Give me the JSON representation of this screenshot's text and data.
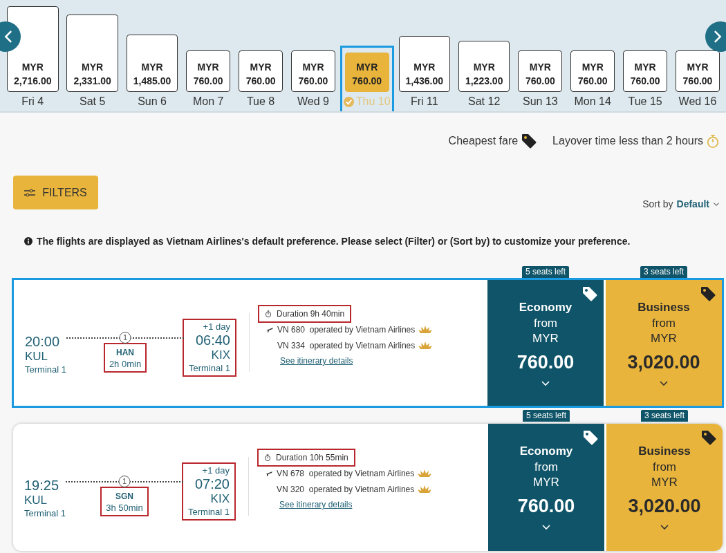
{
  "date_strip": {
    "dates": [
      {
        "day": "Fri 4",
        "currency": "MYR",
        "price": "2,716.00",
        "level": 1.0,
        "selected": false
      },
      {
        "day": "Sat 5",
        "currency": "MYR",
        "price": "2,331.00",
        "level": 0.9,
        "selected": false
      },
      {
        "day": "Sun 6",
        "currency": "MYR",
        "price": "1,485.00",
        "level": 0.67,
        "selected": false
      },
      {
        "day": "Mon 7",
        "currency": "MYR",
        "price": "760.00",
        "level": 0.48,
        "selected": false
      },
      {
        "day": "Tue 8",
        "currency": "MYR",
        "price": "760.00",
        "level": 0.48,
        "selected": false
      },
      {
        "day": "Wed 9",
        "currency": "MYR",
        "price": "760.00",
        "level": 0.48,
        "selected": false
      },
      {
        "day": "Thu 10",
        "currency": "MYR",
        "price": "760.00",
        "level": 0.46,
        "selected": true
      },
      {
        "day": "Fri 11",
        "currency": "MYR",
        "price": "1,436.00",
        "level": 0.65,
        "selected": false
      },
      {
        "day": "Sat 12",
        "currency": "MYR",
        "price": "1,223.00",
        "level": 0.6,
        "selected": false
      },
      {
        "day": "Sun 13",
        "currency": "MYR",
        "price": "760.00",
        "level": 0.48,
        "selected": false
      },
      {
        "day": "Mon 14",
        "currency": "MYR",
        "price": "760.00",
        "level": 0.48,
        "selected": false
      },
      {
        "day": "Tue 15",
        "currency": "MYR",
        "price": "760.00",
        "level": 0.48,
        "selected": false
      },
      {
        "day": "Wed 16",
        "currency": "MYR",
        "price": "760.00",
        "level": 0.48,
        "selected": false
      }
    ]
  },
  "legend": [
    {
      "kind": "cheapest",
      "label": "Cheapest fare"
    },
    {
      "kind": "layover",
      "label": "Layover time less than 2 hours"
    }
  ],
  "filters_button": "FILTERS",
  "sort": {
    "label": "Sort by",
    "value": "Default"
  },
  "notice": "The flights are displayed as Vietnam Airlines's default preference. Please select (Filter) or (Sort by) to customize your preference.",
  "flights": [
    {
      "selected": true,
      "depart": {
        "time": "20:00",
        "airport": "KUL",
        "terminal": "Terminal 1"
      },
      "stop": {
        "count": "1",
        "airport": "HAN",
        "layover": "2h 0min",
        "annotated": true
      },
      "arrive": {
        "day_offset": "+1 day",
        "time": "06:40",
        "airport": "KIX",
        "terminal": "Terminal 1",
        "annotated": true
      },
      "duration": {
        "text": "Duration 9h 40min",
        "annotated": true
      },
      "segments": [
        {
          "kind": "departure",
          "flight": "VN 680",
          "operator": "operated by Vietnam Airlines"
        },
        {
          "kind": "connection",
          "flight": "VN 334",
          "operator": "operated by Vietnam Airlines"
        }
      ],
      "link": "See itinerary details",
      "fares": [
        {
          "kind": "economy",
          "seats": "5 seats left",
          "cabin": "Economy",
          "from": "from",
          "currency": "MYR",
          "price": "760.00"
        },
        {
          "kind": "business",
          "seats": "3 seats left",
          "cabin": "Business",
          "from": "from",
          "currency": "MYR",
          "price": "3,020.00"
        }
      ]
    },
    {
      "selected": false,
      "depart": {
        "time": "19:25",
        "airport": "KUL",
        "terminal": "Terminal 1"
      },
      "stop": {
        "count": "1",
        "airport": "SGN",
        "layover": "3h 50min",
        "annotated": true
      },
      "arrive": {
        "day_offset": "+1 day",
        "time": "07:20",
        "airport": "KIX",
        "terminal": "Terminal 1",
        "annotated": true
      },
      "duration": {
        "text": "Duration 10h 55min",
        "annotated": true
      },
      "segments": [
        {
          "kind": "departure",
          "flight": "VN 678",
          "operator": "operated by Vietnam Airlines"
        },
        {
          "kind": "connection",
          "flight": "VN 320",
          "operator": "operated by Vietnam Airlines"
        }
      ],
      "link": "See itinerary details",
      "fares": [
        {
          "kind": "economy",
          "seats": "5 seats left",
          "cabin": "Economy",
          "from": "from",
          "currency": "MYR",
          "price": "760.00"
        },
        {
          "kind": "business",
          "seats": "3 seats left",
          "cabin": "Business",
          "from": "from",
          "currency": "MYR",
          "price": "3,020.00"
        }
      ]
    }
  ]
}
